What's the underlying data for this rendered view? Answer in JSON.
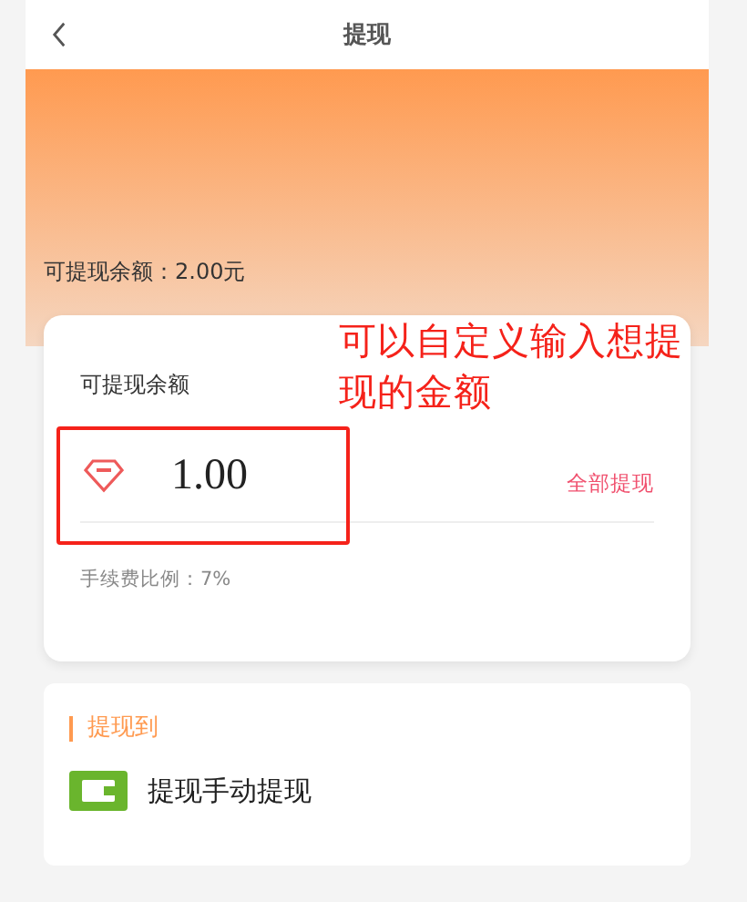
{
  "header": {
    "title": "提现"
  },
  "balance_line": "可提现余额：2.00元",
  "withdraw_card": {
    "label": "可提现余额",
    "amount": "1.00",
    "all_button": "全部提现",
    "fee": "手续费比例：7%"
  },
  "annotation": {
    "text": "可以自定义输入想提现的金额"
  },
  "destination": {
    "title": "提现到",
    "methods": [
      {
        "label": "提现手动提现",
        "kind": "wallet"
      }
    ]
  }
}
